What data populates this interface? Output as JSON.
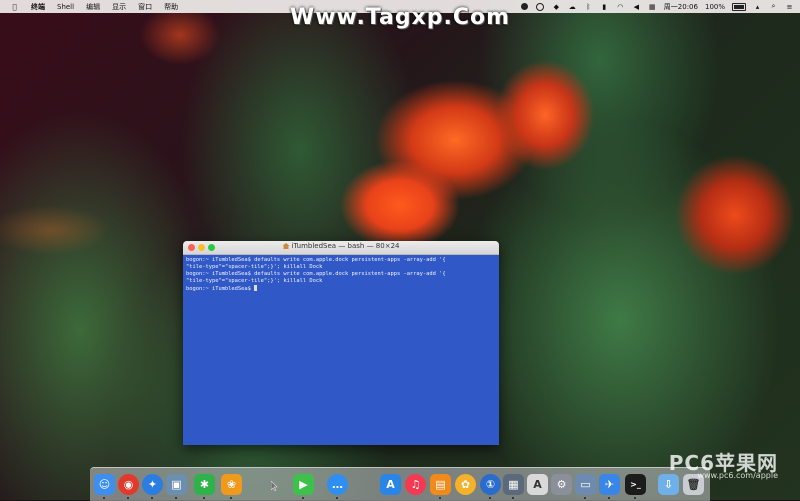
{
  "menubar": {
    "apple_icon": "apple-logo-icon",
    "app_name": "终端",
    "menus": [
      "Shell",
      "编辑",
      "显示",
      "窗口",
      "帮助"
    ],
    "clock": "周一20:06",
    "battery": "100%"
  },
  "watermark": {
    "top": "Www.Tagxp.Com",
    "bottom": "PC6苹果网",
    "bottom_url": "www.pc6.com/apple"
  },
  "terminal": {
    "title": "iTumbledSea — bash — 80×24",
    "lines": [
      "bogon:~ iTumbledSea$ defaults write com.apple.dock persistent-apps -array-add '{",
      "\"tile-type\"=\"spacer-tile\";}'; killall Dock",
      "bogon:~ iTumbledSea$ defaults write com.apple.dock persistent-apps -array-add '{",
      "\"tile-type\"=\"spacer-tile\";}'; killall Dock",
      "bogon:~ iTumbledSea$ "
    ]
  },
  "dock": {
    "items": [
      {
        "name": "finder-icon",
        "color": "#3d8ef0",
        "glyph": "☺"
      },
      {
        "name": "chrome-icon",
        "color": "#e3392d",
        "glyph": "◉"
      },
      {
        "name": "safari-icon",
        "color": "#2a7de1",
        "glyph": "✦"
      },
      {
        "name": "preview-icon",
        "color": "#6c8fb0",
        "glyph": "▣"
      },
      {
        "name": "xmind-icon",
        "color": "#2eb34a",
        "glyph": "✱"
      },
      {
        "name": "butterfly-icon",
        "color": "#f09a1c",
        "glyph": "❀"
      },
      {
        "name": "facetime-icon",
        "color": "#3ec14a",
        "glyph": "▶"
      },
      {
        "name": "messages-icon",
        "color": "#2e8ff0",
        "glyph": "…"
      },
      {
        "name": "app-store-icon",
        "color": "#2a86e6",
        "glyph": "A"
      },
      {
        "name": "music-icon",
        "color": "#f43a52",
        "glyph": "♫"
      },
      {
        "name": "ibooks-icon",
        "color": "#f08a1a",
        "glyph": "▤"
      },
      {
        "name": "photos-icon",
        "color": "#f5b12a",
        "glyph": "✿"
      },
      {
        "name": "1password-icon",
        "color": "#2a6ccc",
        "glyph": "①"
      },
      {
        "name": "photo-slideshow-icon",
        "color": "#5a6a7a",
        "glyph": "▦"
      },
      {
        "name": "font-book-icon",
        "color": "#d9d9d9",
        "glyph": "A"
      },
      {
        "name": "system-preferences-icon",
        "color": "#8a8f99",
        "glyph": "⚙"
      },
      {
        "name": "screenshot-icon",
        "color": "#6d8bb0",
        "glyph": "▭"
      },
      {
        "name": "airdrop-icon",
        "color": "#3a86e8",
        "glyph": "✈"
      },
      {
        "name": "terminal-icon",
        "color": "#1c1c1c",
        "glyph": ">_"
      },
      {
        "name": "downloads-folder-icon",
        "color": "#6fb0e8",
        "glyph": "⇩"
      },
      {
        "name": "trash-icon",
        "color": "#c9cdd2",
        "glyph": "🗑"
      }
    ]
  }
}
